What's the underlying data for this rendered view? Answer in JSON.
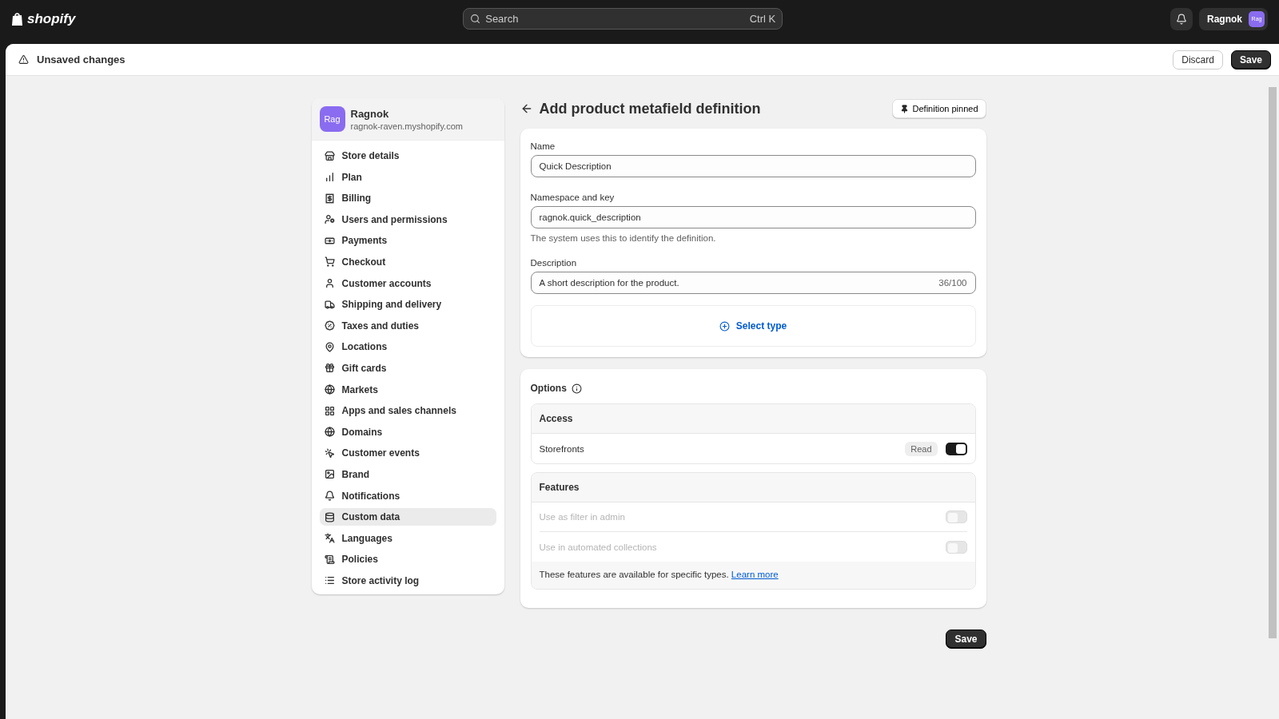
{
  "topbar": {
    "logo": "shopify",
    "search": {
      "placeholder": "Search",
      "shortcut": "Ctrl K"
    },
    "account": {
      "name": "Ragnok",
      "avatar": "Rag"
    }
  },
  "save_bar": {
    "title": "Unsaved changes",
    "buttons": [
      {
        "label": "Discard",
        "kind": "secondary"
      },
      {
        "label": "Save",
        "kind": "primary"
      }
    ]
  },
  "sidebar": {
    "store": {
      "avatar": "Rag",
      "name": "Ragnok",
      "domain": "ragnok-raven.myshopify.com"
    },
    "items": [
      {
        "label": "Store details",
        "selected": false
      },
      {
        "label": "Plan",
        "selected": false
      },
      {
        "label": "Billing",
        "selected": false
      },
      {
        "label": "Users and permissions",
        "selected": false
      },
      {
        "label": "Payments",
        "selected": false
      },
      {
        "label": "Checkout",
        "selected": false
      },
      {
        "label": "Customer accounts",
        "selected": false
      },
      {
        "label": "Shipping and delivery",
        "selected": false
      },
      {
        "label": "Taxes and duties",
        "selected": false
      },
      {
        "label": "Locations",
        "selected": false
      },
      {
        "label": "Gift cards",
        "selected": false
      },
      {
        "label": "Markets",
        "selected": false
      },
      {
        "label": "Apps and sales channels",
        "selected": false
      },
      {
        "label": "Domains",
        "selected": false
      },
      {
        "label": "Customer events",
        "selected": false
      },
      {
        "label": "Brand",
        "selected": false
      },
      {
        "label": "Notifications",
        "selected": false
      },
      {
        "label": "Custom data",
        "selected": true
      },
      {
        "label": "Languages",
        "selected": false
      },
      {
        "label": "Policies",
        "selected": false
      },
      {
        "label": "Store activity log",
        "selected": false
      }
    ]
  },
  "page": {
    "title": "Add product metafield definition",
    "pin_button": "Definition pinned",
    "fields": [
      {
        "label": "Name",
        "value": "Quick Description"
      },
      {
        "label": "Namespace and key",
        "value": "ragnok.quick_description",
        "help": "The system uses this to identify the definition."
      },
      {
        "label": "Description",
        "value": "A short description for the product.",
        "counter": "36/100"
      }
    ],
    "select_type": "Select type",
    "options": {
      "title": "Options",
      "access": {
        "title": "Access",
        "rows": [
          {
            "label": "Storefronts",
            "badge": "Read",
            "on": true,
            "disabled": false
          }
        ]
      },
      "features": {
        "title": "Features",
        "rows": [
          {
            "label": "Use as filter in admin",
            "on": false,
            "disabled": true
          },
          {
            "label": "Use in automated collections",
            "on": false,
            "disabled": true
          }
        ],
        "note": "These features are available for specific types.",
        "link": "Learn more"
      }
    },
    "save": "Save"
  }
}
